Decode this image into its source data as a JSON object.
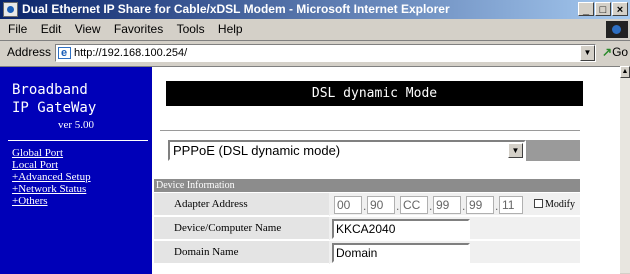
{
  "window": {
    "title": "Dual Ethernet IP Share for Cable/xDSL Modem - Microsoft Internet Explorer",
    "buttons": [
      "_",
      "□",
      "×"
    ]
  },
  "menu": [
    "File",
    "Edit",
    "View",
    "Favorites",
    "Tools",
    "Help"
  ],
  "address": {
    "label": "Address",
    "url": "http://192.168.100.254/",
    "go_label": "Go"
  },
  "sidebar": {
    "brand_line1": "Broadband",
    "brand_line2": "IP GateWay",
    "version": "ver 5.00",
    "links": [
      "Global Port",
      "Local Port",
      "+Advanced Setup",
      "+Network Status",
      "+Others"
    ]
  },
  "main": {
    "header": "DSL dynamic Mode",
    "mode_select": "PPPoE (DSL dynamic mode)",
    "section_title": "Device Information",
    "adapter_label": "Adapter Address",
    "mac": [
      "00",
      "90",
      "CC",
      "99",
      "99",
      "11"
    ],
    "modify_label": "Modify",
    "device_name_label": "Device/Computer Name",
    "device_name_value": "KKCA2040",
    "domain_label": "Domain Name",
    "domain_value": "Domain"
  }
}
